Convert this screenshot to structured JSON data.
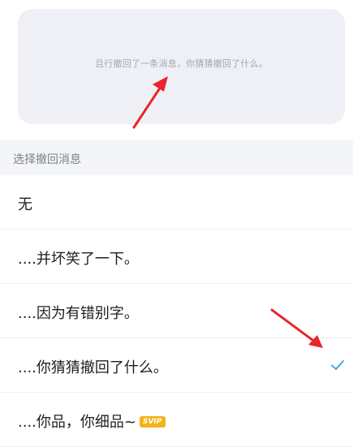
{
  "preview": {
    "text": "且行撤回了一条消息，你猜猜撤回了什么。"
  },
  "section": {
    "header": "选择撤回消息"
  },
  "options": [
    {
      "label": "无",
      "selected": false
    },
    {
      "label": "....并坏笑了一下。",
      "selected": false
    },
    {
      "label": "....因为有错别字。",
      "selected": false
    },
    {
      "label": "....你猜猜撤回了什么。",
      "selected": true
    },
    {
      "label": "....你品，你细品~",
      "selected": false,
      "badge": "SVIP"
    }
  ],
  "colors": {
    "accent": "#2ba3e8",
    "annotation_arrow": "#e8252b",
    "badge": "#f4b21c"
  }
}
